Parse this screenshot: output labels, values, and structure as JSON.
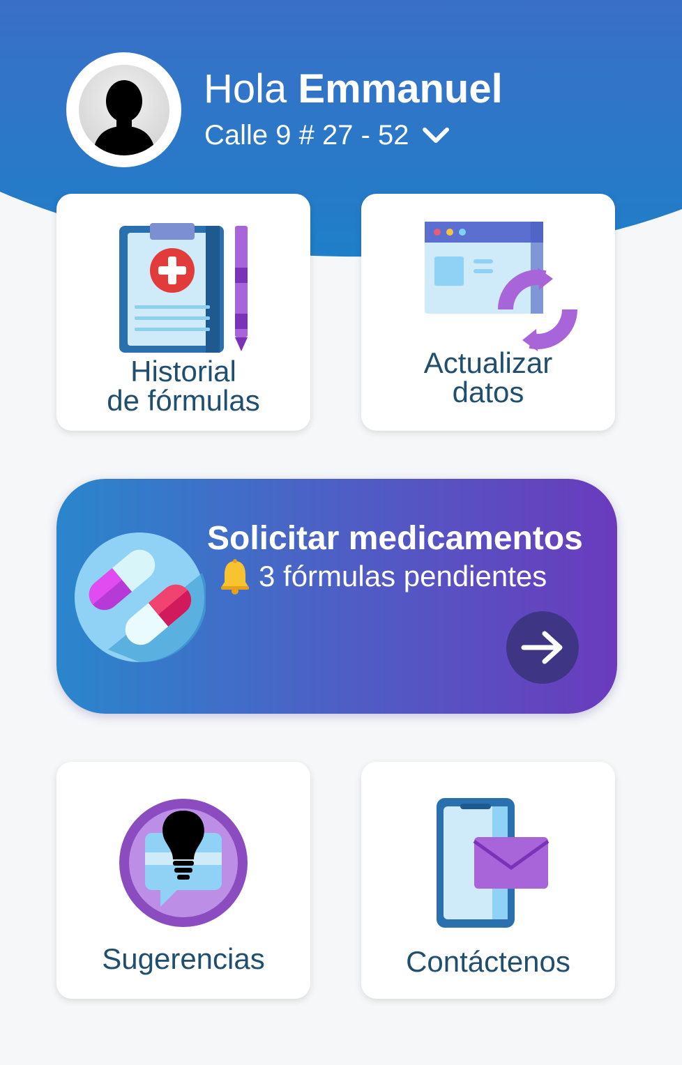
{
  "header": {
    "greeting_prefix": "Hola",
    "user_name": "Emmanuel",
    "address": "Calle 9 # 27 - 52"
  },
  "cards": {
    "historial": {
      "line1": "Historial",
      "line2": "de fórmulas"
    },
    "actualizar": {
      "line1": "Actualizar",
      "line2": "datos"
    },
    "sugerencias": {
      "label": "Sugerencias"
    },
    "contactenos": {
      "label": "Contáctenos"
    }
  },
  "banner": {
    "title": "Solicitar medicamentos",
    "subtitle": "3 fórmulas pendientes"
  },
  "colors": {
    "header_gradient_start": "#2a7bc8",
    "header_gradient_end": "#3d6ec9",
    "banner_start": "#2a86cc",
    "banner_end": "#6a3bbd",
    "text_primary": "#1f4e6e"
  },
  "icons": {
    "avatar": "user-silhouette-icon",
    "address_dropdown": "chevron-down-icon",
    "historial": "clipboard-medical-icon",
    "actualizar": "browser-refresh-icon",
    "banner": "pills-icon",
    "notification": "bell-icon",
    "banner_action": "arrow-right-icon",
    "sugerencias": "lightbulb-chat-icon",
    "contactenos": "phone-mail-icon"
  }
}
